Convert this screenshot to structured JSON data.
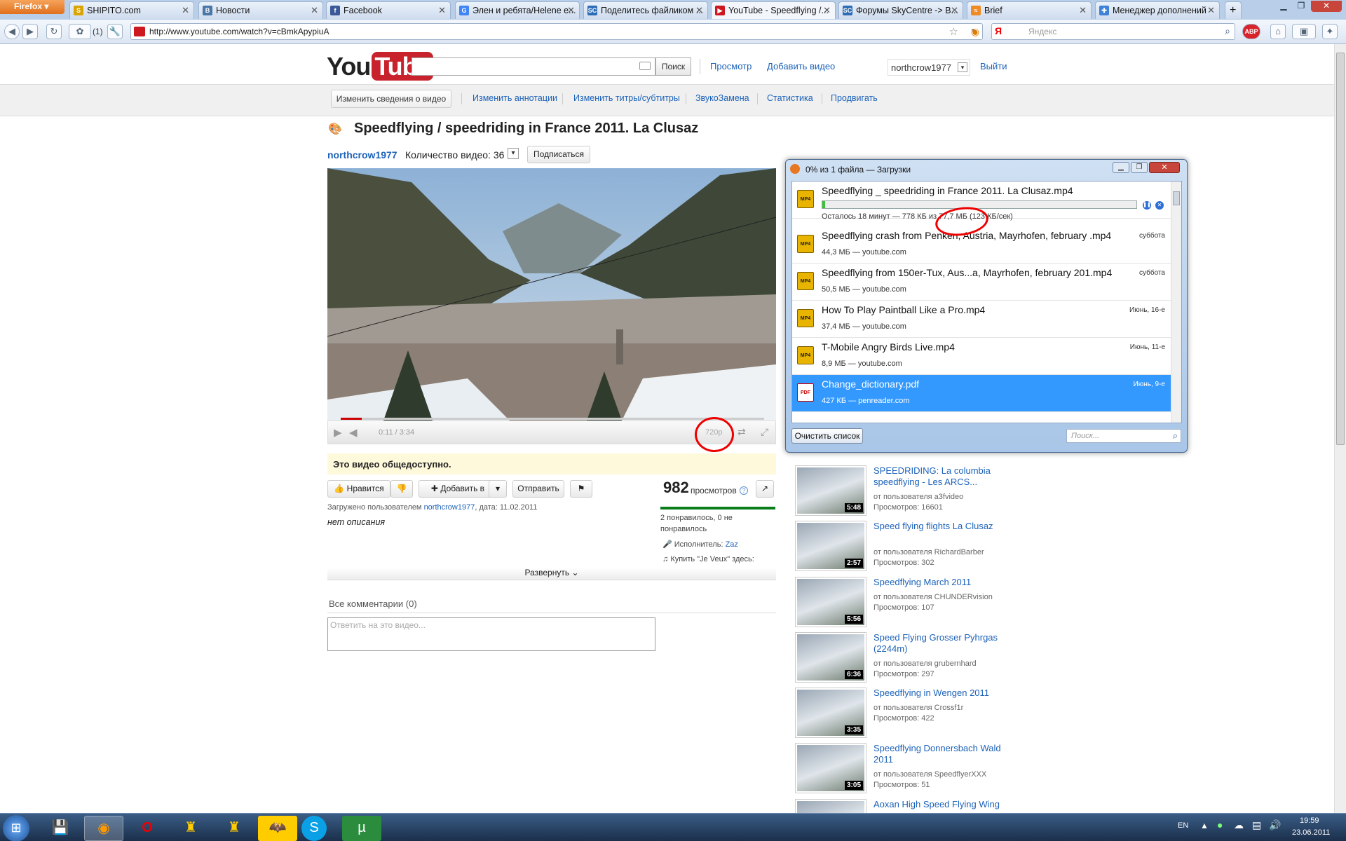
{
  "browser": {
    "menu_button": "Firefox",
    "url": "http://www.youtube.com/watch?v=cBmkApypiuA",
    "notif_count": "(1)",
    "search_placeholder": "Яндекс",
    "tabs": [
      {
        "label": "SHIPITO.com",
        "favicon": "S",
        "color": "#d9a400"
      },
      {
        "label": "Новости",
        "favicon": "B",
        "color": "#4a76a8"
      },
      {
        "label": "Facebook",
        "favicon": "f",
        "color": "#3b5998"
      },
      {
        "label": "Элен и ребята/Helene e...",
        "favicon": "G",
        "color": "#4285f4"
      },
      {
        "label": "Поделитесь файликом ...",
        "favicon": "SC",
        "color": "#2d6db5"
      },
      {
        "label": "YouTube - Speedflying /...",
        "favicon": "▶",
        "color": "#cc181e"
      },
      {
        "label": "Форумы SkyCentre -> B...",
        "favicon": "SC",
        "color": "#2d6db5"
      },
      {
        "label": "Brief",
        "favicon": "≈",
        "color": "#f08a24"
      },
      {
        "label": "Менеджер дополнений",
        "favicon": "✚",
        "color": "#3d82d6"
      }
    ]
  },
  "youtube": {
    "logo_you": "You",
    "logo_tube": "Tube",
    "search_button": "Поиск",
    "nav": {
      "browse": "Просмотр",
      "upload": "Добавить видео",
      "user": "northcrow1977",
      "logout": "Выйти"
    },
    "owner_bar": {
      "edit": "Изменить сведения о видео",
      "links": [
        "Изменить аннотации",
        "Изменить титры/субтитры",
        "ЗвукоЗамена",
        "Статистика",
        "Продвигать"
      ]
    },
    "video": {
      "title": "Speedflying / speedriding in France 2011. La Clusaz",
      "channel": "northcrow1977",
      "video_count": "Количество видео: 36",
      "subscribe": "Подписаться",
      "time": "0:11 / 3:34",
      "quality": "720p",
      "progress": 0.05,
      "public_note": "Это видео общедоступно.",
      "like": "Нравится",
      "add_to": "Добавить в",
      "share": "Отправить",
      "views": "982",
      "views_label": "просмотров",
      "uploaded_prefix": "Загружено пользователем",
      "uploaded_user": "northcrow1977",
      "uploaded_date": ", дата: 11.02.2011",
      "no_description": "нет описания",
      "ratings": "2 понравилось, 0 не понравилось",
      "artist_label": "Исполнитель:",
      "artist": "Zaz",
      "buy": "Купить \"Je Veux\" здесь:",
      "expand": "Развернуть",
      "comments_header": "Все комментарии (0)",
      "comment_placeholder": "Ответить на это видео..."
    },
    "related": [
      {
        "title": "SPEEDRIDING: La columbia speedflying - Les ARCS...",
        "by": "от пользователя a3fvideo",
        "views": "Просмотров: 16601",
        "duration": "5:48"
      },
      {
        "title": "Speed flying flights La Clusaz",
        "by": "от пользователя RichardBarber",
        "views": "Просмотров: 302",
        "duration": "2:57"
      },
      {
        "title": "Speedflying March 2011",
        "by": "от пользователя CHUNDERvision",
        "views": "Просмотров: 107",
        "duration": "5:56"
      },
      {
        "title": "Speed Flying Grosser Pyhrgas (2244m)",
        "by": "от пользователя grubernhard",
        "views": "Просмотров: 297",
        "duration": "6:36"
      },
      {
        "title": "Speedflying in Wengen 2011",
        "by": "от пользователя Crossf1r",
        "views": "Просмотров: 422",
        "duration": "3:35"
      },
      {
        "title": "Speedflying Donnersbach Wald 2011",
        "by": "от пользователя SpeedflyerXXX",
        "views": "Просмотров: 51",
        "duration": "3:05"
      },
      {
        "title": "Aoxan High Speed Flying Wing",
        "by": "",
        "views": "",
        "duration": ""
      }
    ]
  },
  "downloads": {
    "title": "0% из 1 файла — Загрузки",
    "clear": "Очистить список",
    "search_placeholder": "Поиск...",
    "active": {
      "name": "Speedflying _ speedriding in France 2011. La Clusaz.mp4",
      "status": "Осталось 18 минут — 778 КБ из 77,7 МБ (123 КБ/сек)",
      "progress": 0.01
    },
    "items": [
      {
        "name": "Speedflying crash from Penken, Austria, Mayrhofen, february .mp4",
        "status": "44,3 МБ — youtube.com",
        "date": "суббота",
        "type": "video"
      },
      {
        "name": "Speedflying from 150er-Tux, Aus...a, Mayrhofen, february 201.mp4",
        "status": "50,5 МБ — youtube.com",
        "date": "суббота",
        "type": "video"
      },
      {
        "name": "How To Play Paintball Like a Pro.mp4",
        "status": "37,4 МБ — youtube.com",
        "date": "Июнь, 16-е",
        "type": "video"
      },
      {
        "name": "T-Mobile Angry Birds Live.mp4",
        "status": "8,9 МБ — youtube.com",
        "date": "Июнь, 11-е",
        "type": "video"
      },
      {
        "name": "Change_dictionary.pdf",
        "status": "427 КБ — penreader.com",
        "date": "Июнь, 9-е",
        "type": "pdf"
      }
    ]
  },
  "taskbar": {
    "lang": "EN",
    "time": "19:59",
    "date": "23.06.2011"
  }
}
